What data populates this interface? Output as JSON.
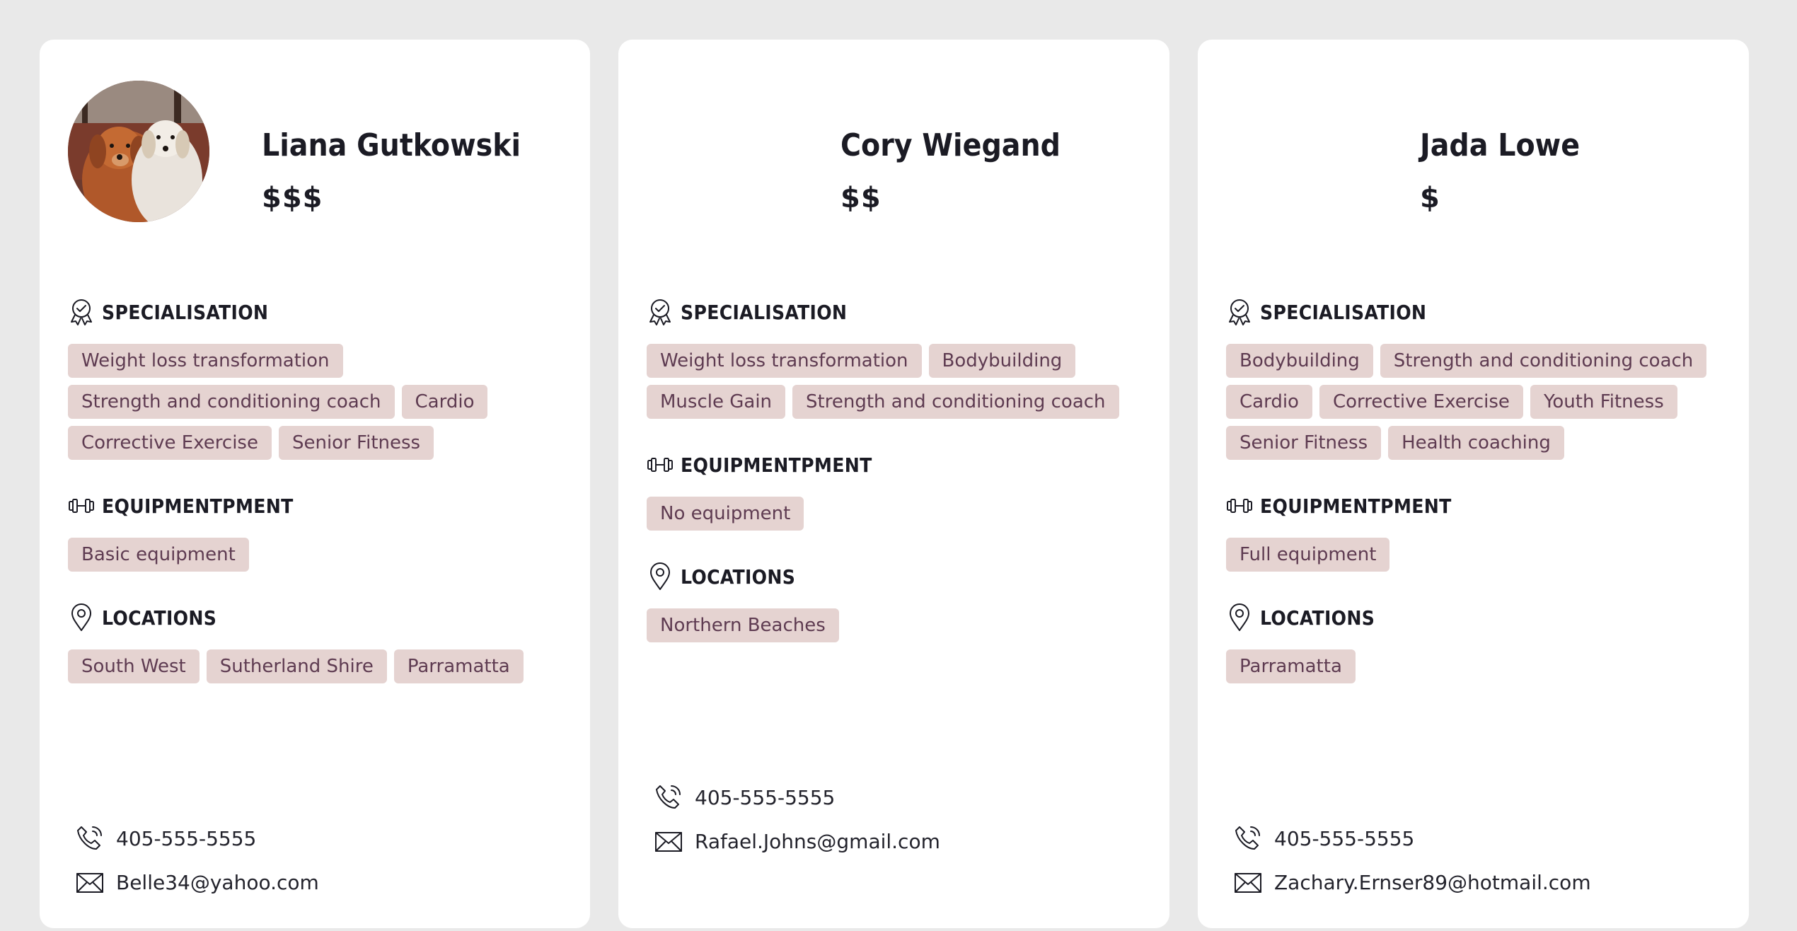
{
  "section_titles": {
    "specialisation": "SPECIALISATION",
    "equipment": "EQUIPMENTPMENT",
    "locations": "LOCATIONS"
  },
  "icons": {
    "specialisation": "award-badge-icon",
    "equipment": "dumbbell-icon",
    "locations": "map-pin-icon",
    "phone": "phone-icon",
    "email": "envelope-icon",
    "avatar": "dogs-photo"
  },
  "colors": {
    "page_background": "#e9e9e9",
    "card_background": "#ffffff",
    "tag_background": "#e5d3d1",
    "tag_text": "#5e3b51",
    "heading_text": "#1b1b24"
  },
  "trainers": [
    {
      "name": "Liana Gutkowski",
      "price": "$$$",
      "specialisations": [
        "Weight loss transformation",
        "Strength and conditioning coach",
        "Cardio",
        "Corrective Exercise",
        "Senior Fitness"
      ],
      "equipment": [
        "Basic equipment"
      ],
      "locations": [
        "South West",
        "Sutherland Shire",
        "Parramatta"
      ],
      "phone": "405-555-5555",
      "email": "Belle34@yahoo.com"
    },
    {
      "name": "Cory Wiegand",
      "price": "$$",
      "specialisations": [
        "Weight loss transformation",
        "Bodybuilding",
        "Muscle Gain",
        "Strength and conditioning coach"
      ],
      "equipment": [
        "No equipment"
      ],
      "locations": [
        "Northern Beaches"
      ],
      "phone": "405-555-5555",
      "email": "Rafael.Johns@gmail.com"
    },
    {
      "name": "Jada Lowe",
      "price": "$",
      "specialisations": [
        "Bodybuilding",
        "Strength and conditioning coach",
        "Cardio",
        "Corrective Exercise",
        "Youth Fitness",
        "Senior Fitness",
        "Health coaching"
      ],
      "equipment": [
        "Full equipment"
      ],
      "locations": [
        "Parramatta"
      ],
      "phone": "405-555-5555",
      "email": "Zachary.Ernser89@hotmail.com"
    }
  ]
}
